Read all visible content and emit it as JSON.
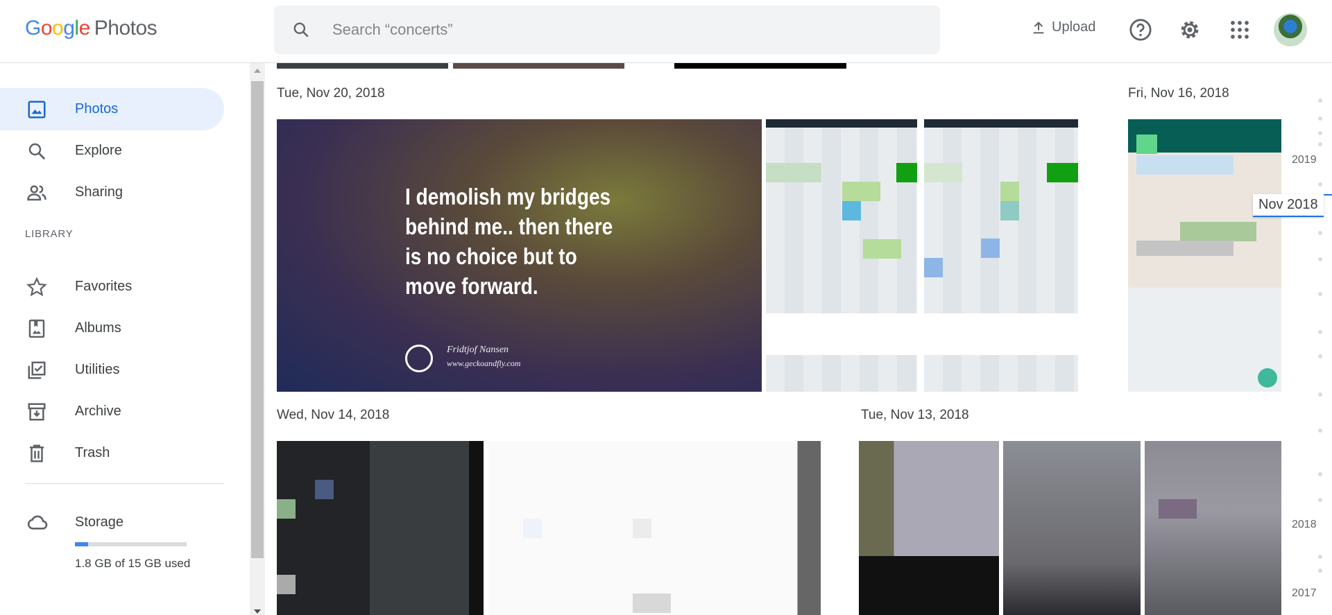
{
  "header": {
    "logo_parts": [
      "G",
      "o",
      "o",
      "g",
      "l",
      "e"
    ],
    "logo_product": "Photos",
    "search_placeholder": "Search “concerts”",
    "upload_label": "Upload",
    "icons": [
      "search-icon",
      "upload-icon",
      "help-icon",
      "settings-icon",
      "apps-icon",
      "avatar"
    ]
  },
  "sidebar": {
    "items": [
      {
        "label": "Photos",
        "icon": "photo-icon",
        "active": true
      },
      {
        "label": "Explore",
        "icon": "search-icon"
      },
      {
        "label": "Sharing",
        "icon": "people-icon"
      }
    ],
    "library_heading": "LIBRARY",
    "library_items": [
      {
        "label": "Favorites",
        "icon": "star-icon"
      },
      {
        "label": "Albums",
        "icon": "album-icon"
      },
      {
        "label": "Utilities",
        "icon": "utilities-icon"
      },
      {
        "label": "Archive",
        "icon": "archive-icon"
      },
      {
        "label": "Trash",
        "icon": "trash-icon"
      }
    ],
    "storage": {
      "label": "Storage",
      "used_text": "1.8 GB of 15 GB used",
      "used_fraction": 0.12
    }
  },
  "content": {
    "groups": [
      {
        "date": "Tue, Nov 20, 2018"
      },
      {
        "date": "Fri, Nov 16, 2018"
      },
      {
        "date": "Wed, Nov 14, 2018"
      },
      {
        "date": "Tue, Nov 13, 2018"
      }
    ],
    "quote_photo": {
      "text": "I demolish my bridges behind me.. then there is no choice but to move forward.",
      "author": "Fridtjof Nansen",
      "site": "www.geckoandfly.com"
    }
  },
  "timeline": {
    "years": [
      "2019",
      "2018",
      "2017"
    ],
    "current": "Nov 2018"
  },
  "colors": {
    "accent": "#1a73e8",
    "active_bg": "#e8f0fe",
    "storage_fill": "#4285f4"
  }
}
